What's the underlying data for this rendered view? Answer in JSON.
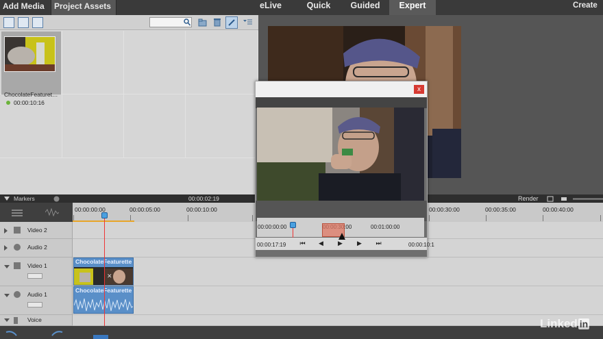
{
  "topbar": {
    "add_media": "Add Media",
    "project_assets": "Project Assets",
    "modes": [
      "eLive",
      "Quick",
      "Guided",
      "Expert"
    ],
    "active_mode": "Expert",
    "create": "Create"
  },
  "assets": {
    "item_name": "ChocolateFeaturet…",
    "item_duration": "00:00:10:16"
  },
  "timeline": {
    "markers": "Markers",
    "header_time": "00:00:02:19",
    "render": "Render",
    "ruler": [
      "00:00:00:00",
      "00:00:05:00",
      "00:00:10:00",
      "00:00:30:00",
      "00:00:35:00",
      "00:00:40:00"
    ],
    "tracks": [
      {
        "name": "Video 2"
      },
      {
        "name": "Audio 2"
      },
      {
        "name": "Video 1"
      },
      {
        "name": "Audio 1"
      },
      {
        "name": "Voice"
      }
    ],
    "clip_video_label": "ChocolateFeaturette",
    "clip_audio_label": "ChocolateFeaturette"
  },
  "dialog": {
    "close": "x",
    "scrub_start": "00:00:00:00",
    "scrub_mid": "00:00:30:00",
    "scrub_end": "00:01:00:00",
    "current_time": "00:00:17:19",
    "end_time": "00:00:10:1"
  },
  "watermark": {
    "brand": "Linked",
    "brand_in": "in"
  }
}
